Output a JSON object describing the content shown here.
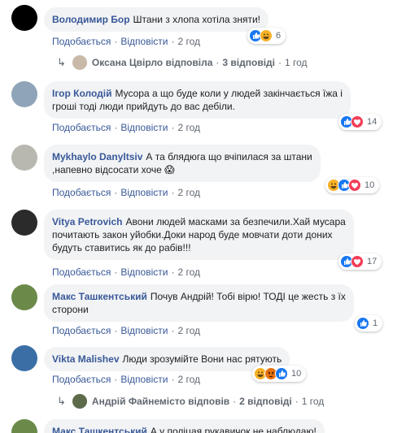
{
  "labels": {
    "like": "Подобається",
    "reply": "Відповісти",
    "sep": "·"
  },
  "comments": [
    {
      "author": "Володимир Бор",
      "text": "Штани з хлопа хотіла зняти!",
      "time": "2 год",
      "reactions": [
        "like",
        "haha"
      ],
      "reaction_count": "6",
      "replies": {
        "name": "Оксана Цвірло",
        "verb": "відповіла",
        "count": "3 відповіді",
        "time": "1 год"
      }
    },
    {
      "author": "Ігор Колодій",
      "text_line1": "Мусора а що буде коли у людей закінчається їжа і",
      "text_line2": "гроші тоді люди прийдуть до вас дебіли.",
      "time": "2 год",
      "reactions": [
        "like",
        "love"
      ],
      "reaction_count": "14"
    },
    {
      "author": "Mykhaylo Danyltsiv",
      "text_line1": "А та блядюга що вчіпилася за штани",
      "text_line2": ",напевно відсосати хоче 😱",
      "time": "2 год",
      "reactions": [
        "haha",
        "like",
        "love"
      ],
      "reaction_count": "10"
    },
    {
      "author": "Vitya Petrovich",
      "text_line1": "Авони людей масками за безпечили.Хай мусара",
      "text_line2": "почитають закон уйобки.Доки народ буде мовчати доти доних",
      "text_line3": "будуть ставитись як до рабів!!!",
      "time": "2 год",
      "reactions": [
        "like",
        "love"
      ],
      "reaction_count": "17"
    },
    {
      "author": "Макс Ташкентський",
      "text_line1": "Почув Андрій! Тобі вірю! ТОДІ це жесть з їх",
      "text_line2": "сторони",
      "time": "2 год",
      "reactions": [
        "like"
      ],
      "reaction_count": "1"
    },
    {
      "author": "Vikta Malishev",
      "text": "Люди зрозумійте Вони нас рятують",
      "time": "2 год",
      "reactions": [
        "haha",
        "angry",
        "like"
      ],
      "reaction_count": "10",
      "replies": {
        "name": "Андрій Файнеміcто",
        "verb": "відповів",
        "count": "2 відповіді",
        "time": "1 год"
      }
    },
    {
      "author": "Макс Ташкентський",
      "text": "А у поліцая рукавичок не наблюдаю!"
    }
  ],
  "colors": {
    "link": "#385898",
    "meta": "#606770",
    "bubble": "#f2f3f5",
    "like": "#1877f2",
    "love": "#f33e58",
    "haha": "#f7b125"
  },
  "icons": {
    "reply_arrow": "↳"
  }
}
